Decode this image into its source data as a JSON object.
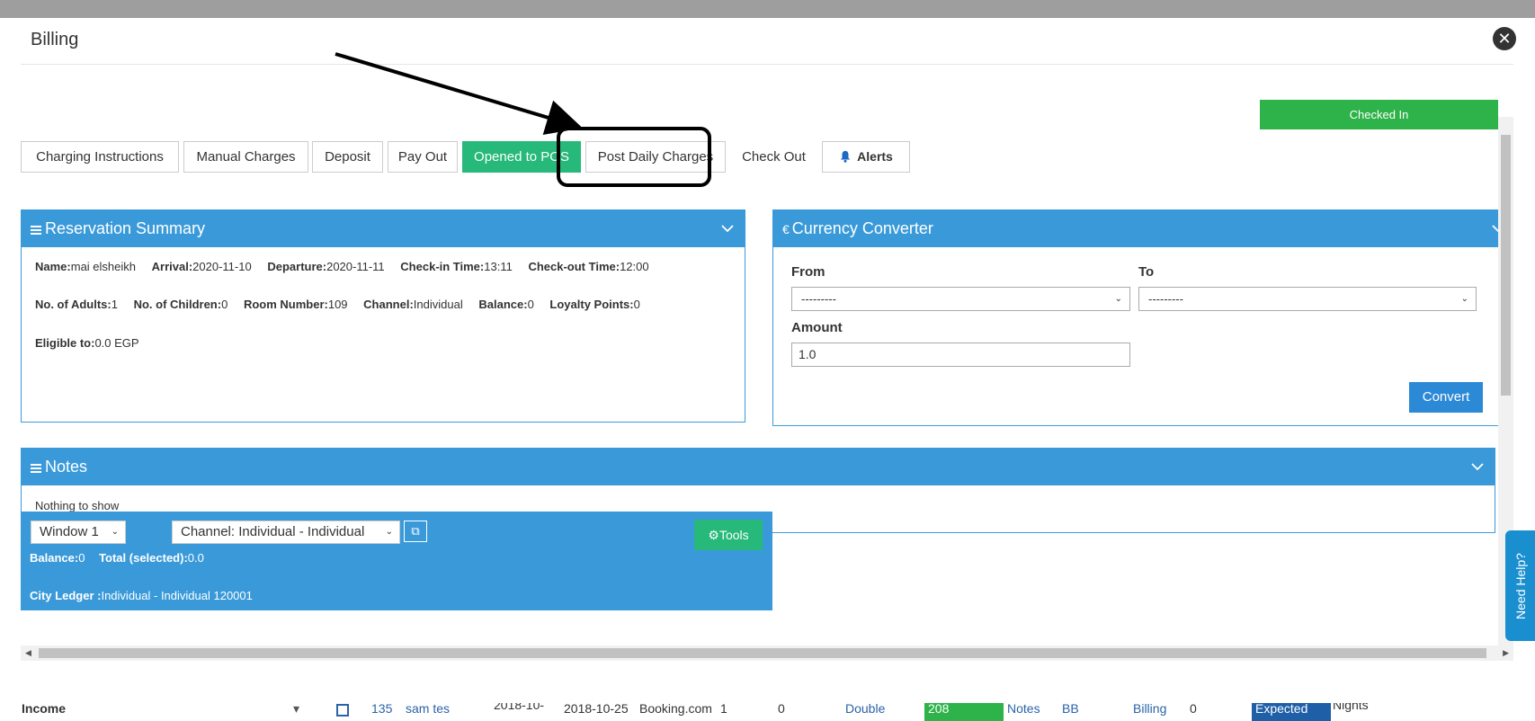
{
  "background_row": {
    "income": "Income",
    "id": "135",
    "name": "sam tes",
    "date1": "2018-10-",
    "date2": "2018-10-25",
    "channel": "Booking.com",
    "num": "1",
    "zero": "0",
    "room_type": "Double",
    "room": "208",
    "notes": "Notes",
    "board": "BB",
    "billing": "Billing",
    "zero2": "0",
    "status": "Expected",
    "nights": "Nights"
  },
  "modal": {
    "title": "Billing",
    "close_icon": "close-icon"
  },
  "status": {
    "label": "Checked In",
    "color": "#2eb24a"
  },
  "toolbar": {
    "charging_instructions": "Charging Instructions",
    "manual_charges": "Manual Charges",
    "deposit": "Deposit",
    "pay_out": "Pay Out",
    "opened_to_pos": "Opened to POS",
    "post_daily_charges": "Post Daily Charges",
    "check_out": "Check Out",
    "alerts": "Alerts"
  },
  "reservation_summary": {
    "title": "Reservation Summary",
    "name_k": "Name:",
    "name_v": "mai elsheikh",
    "arrival_k": "Arrival:",
    "arrival_v": "2020-11-10",
    "departure_k": "Departure:",
    "departure_v": "2020-11-11",
    "checkin_k": "Check-in Time:",
    "checkin_v": "13:11",
    "checkout_k": "Check-out Time:",
    "checkout_v": "12:00",
    "adults_k": "No. of Adults:",
    "adults_v": "1",
    "children_k": "No. of Children:",
    "children_v": "0",
    "room_k": "Room Number:",
    "room_v": "109",
    "channel_k": "Channel:",
    "channel_v": "Individual",
    "balance_k": "Balance:",
    "balance_v": "0",
    "loyalty_k": "Loyalty Points:",
    "loyalty_v": "0",
    "eligible_k": "Eligible to:",
    "eligible_v": "0.0 EGP"
  },
  "currency_converter": {
    "title": "Currency Converter",
    "symbol": "€",
    "from_label": "From",
    "to_label": "To",
    "from_value": "---------",
    "to_value": "---------",
    "amount_label": "Amount",
    "amount_value": "1.0",
    "convert_label": "Convert"
  },
  "notes": {
    "title": "Notes",
    "empty": "Nothing to show"
  },
  "window_panel": {
    "window_select": "Window 1",
    "channel_select": "Channel: Individual - Individual",
    "tools_label": "Tools",
    "balance_k": "Balance:",
    "balance_v": "0",
    "total_k": "Total (selected):",
    "total_v": "0.0",
    "ledger_k": "City Ledger :",
    "ledger_v": "Individual - Individual 120001"
  },
  "help": {
    "label": "Need Help?"
  }
}
